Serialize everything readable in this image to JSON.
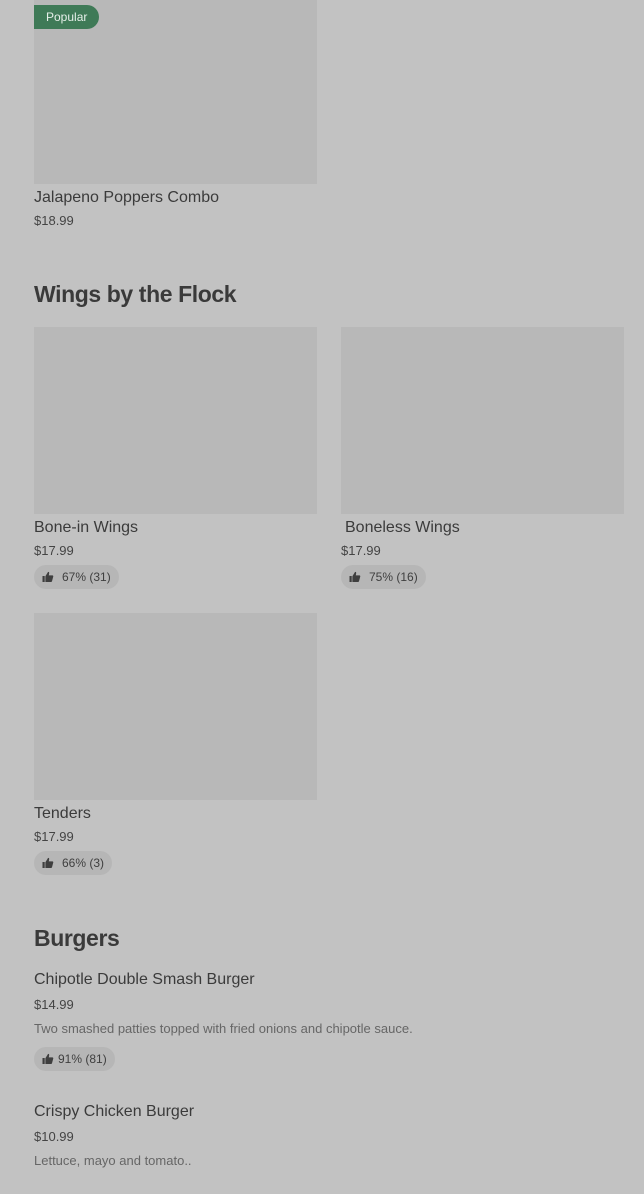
{
  "top_item": {
    "badge": "Popular",
    "title": "Jalapeno Poppers Combo",
    "price": "$18.99"
  },
  "wings_section": {
    "title": "Wings by the Flock",
    "items": [
      {
        "title": "Bone-in Wings",
        "price": "$17.99",
        "rating": "67% (31)"
      },
      {
        "title": "Boneless Wings",
        "price": "$17.99",
        "rating": "75% (16)"
      },
      {
        "title": "Tenders",
        "price": "$17.99",
        "rating": "66% (3)"
      }
    ]
  },
  "burgers_section": {
    "title": "Burgers",
    "items": [
      {
        "title": "Chipotle Double Smash Burger",
        "price": "$14.99",
        "description": "Two smashed patties topped with fried onions and chipotle sauce.",
        "rating": "91% (81)"
      },
      {
        "title": "Crispy Chicken Burger",
        "price": "$10.99",
        "description": "Lettuce, mayo and tomato.."
      }
    ]
  },
  "icons": {
    "rating": "thumbs-up-icon"
  },
  "colors": {
    "background": "#c2c2c2",
    "image_placeholder": "#b8b8b8",
    "popular_badge": "#3f7a57",
    "rating_pill": "#b6b6b6"
  }
}
